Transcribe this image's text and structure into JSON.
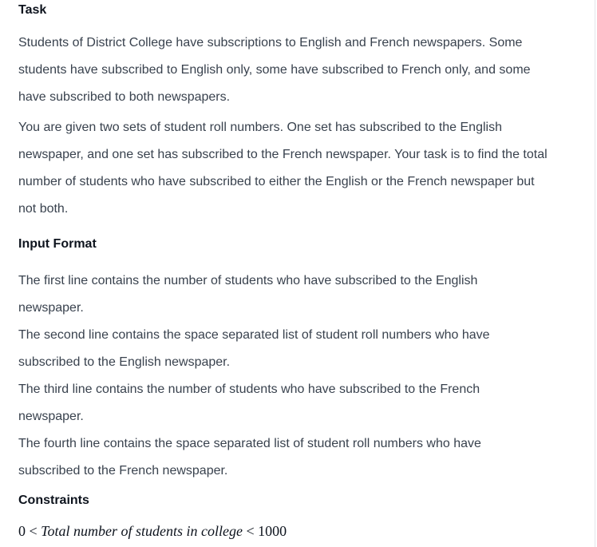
{
  "task": {
    "title": "Task",
    "paragraph1": "Students of District College have subscriptions to English and French newspapers. Some\nstudents have subscribed to English only, some have subscribed to French only, and some\nhave subscribed to both newspapers.",
    "paragraph2": "You are given two sets of student roll numbers. One set has subscribed to the English\nnewspaper, and one set has subscribed to the French newspaper. Your task is to find the total\nnumber of students who have subscribed to either the English or the French newspaper but\nnot both."
  },
  "input_format": {
    "title": "Input Format",
    "lines": "The first line contains the number of students who have subscribed to the English\nnewspaper.\nThe second line contains the space separated list of student roll numbers who have\nsubscribed to the English newspaper.\nThe third line contains the number of students who have subscribed to the French\nnewspaper.\nThe fourth line contains the space separated list of student roll numbers who have\nsubscribed to the French newspaper."
  },
  "constraints": {
    "title": "Constraints",
    "formula_left": "0 < ",
    "formula_var": "Total number of students in college",
    "formula_right": " < 1000"
  }
}
